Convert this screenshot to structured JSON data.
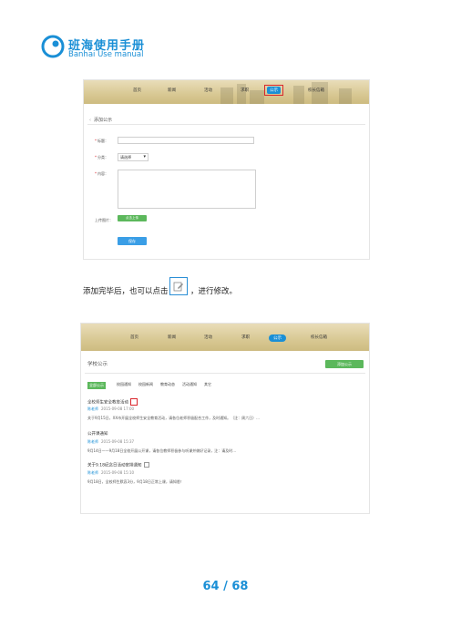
{
  "brand": {
    "name_cn": "班海使用手册",
    "name_en": "Banhai Use manual"
  },
  "screenshot1": {
    "nav": [
      "首页",
      "新闻",
      "活动",
      "求职",
      "公示",
      "校长信箱"
    ],
    "active_nav": "公示",
    "form": {
      "title": "添加公示",
      "title_label": "标题：",
      "category_label": "分类：",
      "category_value": "请选择",
      "content_label": "内容：",
      "upload_label": "上传图片：",
      "upload_button": "点击上传",
      "submit_button": "保存"
    }
  },
  "instruction": {
    "before_icon": "添加完毕后，也可以点击",
    "after_icon": "，进行修改。",
    "icon": "edit-icon"
  },
  "screenshot2": {
    "nav": [
      "首页",
      "新闻",
      "活动",
      "求职",
      "公示",
      "校长信箱"
    ],
    "active_nav": "公示",
    "page_title": "学校公示",
    "publish_button": "添加公示",
    "tabs": [
      "全部公示",
      "校园通知",
      "校园新闻",
      "教育动态",
      "活动通知",
      "其它"
    ],
    "posts": [
      {
        "title": "全校师生安全教育活动",
        "author": "陈老师",
        "date": "2015-09-08 17:00",
        "summary": "关于9月15日，XX市开展全校师生安全教育活动，请各位老师积极配合工作，及时通知。（注：周六日）..."
      },
      {
        "title": "公开课通知",
        "author": "陈老师",
        "date": "2015-09-08 15:37",
        "summary": "9月14日——9月18日全校开展公开课，请各位教师积极参与听课并做好记录，注：请及时..."
      },
      {
        "title": "关于9.18纪念日活动安排通知",
        "author": "陈老师",
        "date": "2015-09-08 15:10",
        "summary": "9月18日，全校师生默哀3分，9月18日正常上课，请知悉！"
      }
    ]
  },
  "page_number": "64 / 68",
  "colors": {
    "brand_blue": "#1a8fd6",
    "highlight_red": "#d9262c",
    "green": "#5cb85c"
  }
}
